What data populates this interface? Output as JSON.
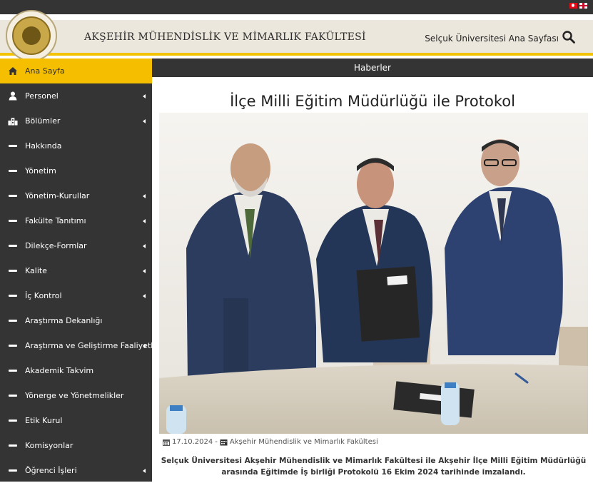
{
  "header": {
    "faculty_title": "AKŞEHİR MÜHENDİSLİK VE MİMARLIK FAKÜLTESİ",
    "home_link": "Selçuk Üniversitesi Ana Sayfası",
    "logo_text": "SELÇUK ÜNİVERSİTESİ KONYA 1975"
  },
  "sidebar": {
    "items": [
      {
        "label": "Ana Sayfa",
        "icon": "home-icon",
        "active": true,
        "submenu": false
      },
      {
        "label": "Personel",
        "icon": "user-icon",
        "active": false,
        "submenu": true
      },
      {
        "label": "Bölümler",
        "icon": "building-icon",
        "active": false,
        "submenu": true
      },
      {
        "label": "Hakkında",
        "icon": "dash-icon",
        "active": false,
        "submenu": false
      },
      {
        "label": "Yönetim",
        "icon": "dash-icon",
        "active": false,
        "submenu": false
      },
      {
        "label": "Yönetim-Kurullar",
        "icon": "dash-icon",
        "active": false,
        "submenu": true
      },
      {
        "label": "Fakülte Tanıtımı",
        "icon": "dash-icon",
        "active": false,
        "submenu": true
      },
      {
        "label": "Dilekçe-Formlar",
        "icon": "dash-icon",
        "active": false,
        "submenu": true
      },
      {
        "label": "Kalite",
        "icon": "dash-icon",
        "active": false,
        "submenu": true
      },
      {
        "label": "İç Kontrol",
        "icon": "dash-icon",
        "active": false,
        "submenu": true
      },
      {
        "label": "Araştırma Dekanlığı",
        "icon": "dash-icon",
        "active": false,
        "submenu": false
      },
      {
        "label": "Araştırma ve Geliştirme Faaliyetleri",
        "icon": "dash-icon",
        "active": false,
        "submenu": true
      },
      {
        "label": "Akademik Takvim",
        "icon": "dash-icon",
        "active": false,
        "submenu": false
      },
      {
        "label": "Yönerge ve Yönetmelikler",
        "icon": "dash-icon",
        "active": false,
        "submenu": false
      },
      {
        "label": "Etik Kurul",
        "icon": "dash-icon",
        "active": false,
        "submenu": false
      },
      {
        "label": "Komisyonlar",
        "icon": "dash-icon",
        "active": false,
        "submenu": false
      },
      {
        "label": "Öğrenci İşleri",
        "icon": "dash-icon",
        "active": false,
        "submenu": true
      }
    ]
  },
  "main": {
    "section_title": "Haberler",
    "news_title": "İlçe Milli Eğitim Müdürlüğü ile Protokol",
    "date": "17.10.2024",
    "separator": "-",
    "unit": "Akşehir Mühendislik ve Mimarlık Fakültesi",
    "summary": "Selçuk Üniversitesi Akşehir Mühendislik ve Mimarlık Fakültesi ile Akşehir İlçe Milli Eğitim Müdürlüğü arasında Eğitimde İş birliği Protokolü 16 Ekim 2024 tarihinde imzalandı."
  },
  "colors": {
    "dark": "#343434",
    "accent": "#f5bf00",
    "header_bg": "#ece7dd"
  }
}
